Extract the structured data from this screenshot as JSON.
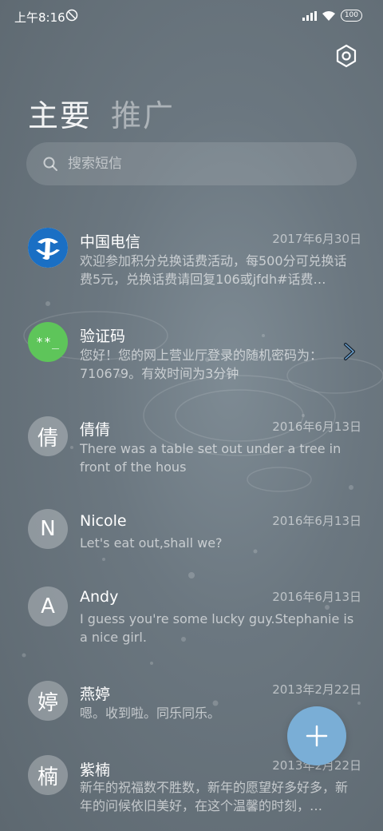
{
  "status": {
    "time": "上午8:16",
    "battery": "100"
  },
  "tabs": [
    {
      "label": "主要"
    },
    {
      "label": "推广"
    }
  ],
  "search": {
    "placeholder": "搜索短信"
  },
  "conversations": [
    {
      "name": "中国电信",
      "date": "2017年6月30日",
      "preview": "欢迎参加积分兑换话费活动，每500分可兑换话费5元，兑换话费请回复106或jfdh#话费…",
      "avatar": ""
    },
    {
      "name": "验证码",
      "date": "",
      "preview": "您好！您的网上营业厅登录的随机密码为：710679。有效时间为3分钟",
      "avatar": "**_"
    },
    {
      "name": "倩倩",
      "date": "2016年6月13日",
      "preview": "There was a table set out under a tree in front of the hous",
      "avatar": "倩"
    },
    {
      "name": "Nicole",
      "date": "2016年6月13日",
      "preview": "Let's eat out,shall we?",
      "avatar": "N"
    },
    {
      "name": "Andy",
      "date": "2016年6月13日",
      "preview": "I guess you're some lucky guy.Stephanie is a nice girl.",
      "avatar": "A"
    },
    {
      "name": "燕婷",
      "date": "2013年2月22日",
      "preview": "嗯。收到啦。同乐同乐。",
      "avatar": "婷"
    },
    {
      "name": "紫楠",
      "date": "2013年2月22日",
      "preview": "新年的祝福数不胜数，新年的愿望好多好多，新年的问候依旧美好，在这个温馨的时刻，…",
      "avatar": "楠"
    }
  ],
  "colors": {
    "accent": "#7aaed6",
    "code_avatar": "#5ec55a",
    "telecom": "#1a6fc4"
  }
}
